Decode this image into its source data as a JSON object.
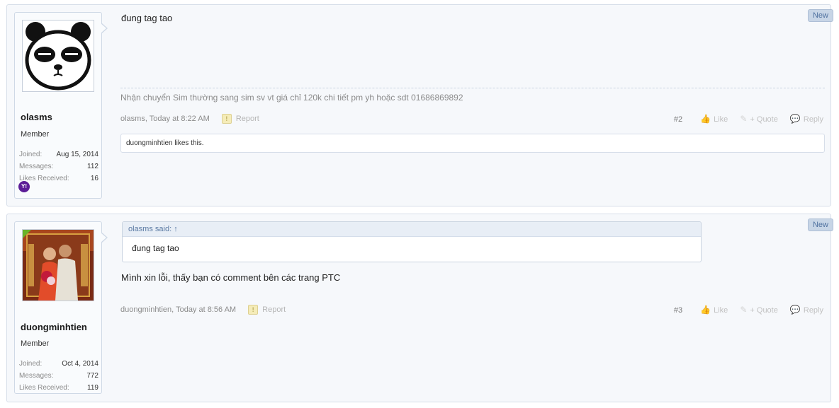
{
  "posts": [
    {
      "username": "olasms",
      "user_title": "Member",
      "stats": {
        "joined_label": "Joined:",
        "joined": "Aug 15, 2014",
        "messages_label": "Messages:",
        "messages": "112",
        "likes_label": "Likes Received:",
        "likes": "16"
      },
      "message": "đung tag tao",
      "signature": "Nhận chuyển Sim thường sang sim sv vt giá chỉ 120k chi tiết pm yh hoặc sdt 01686869892",
      "author_meta": "olasms, Today at 8:22 AM",
      "report_label": "Report",
      "post_number": "#2",
      "like_label": "Like",
      "quote_label": "+ Quote",
      "reply_label": "Reply",
      "likes_text": "duongminhtien likes this.",
      "badge": "New",
      "contact_icon": "yahoo-messenger-icon"
    },
    {
      "username": "duongminhtien",
      "user_title": "Member",
      "stats": {
        "joined_label": "Joined:",
        "joined": "Oct 4, 2014",
        "messages_label": "Messages:",
        "messages": "772",
        "likes_label": "Likes Received:",
        "likes": "119"
      },
      "quote": {
        "header": "olasms said: ↑",
        "body": "đung tag tao"
      },
      "message": "Mình xin lỗi, thấy bạn có comment bên các trang PTC",
      "author_meta": "duongminhtien, Today at 8:56 AM",
      "report_label": "Report",
      "post_number": "#3",
      "like_label": "Like",
      "quote_label": "+ Quote",
      "reply_label": "Reply",
      "badge": "New"
    }
  ],
  "colors": {
    "post_bg": "#f6f8fb",
    "border": "#d7dee9",
    "badge_bg": "#c7d5e6",
    "online": "#6ab42a",
    "yahoo": "#5c1d97"
  }
}
